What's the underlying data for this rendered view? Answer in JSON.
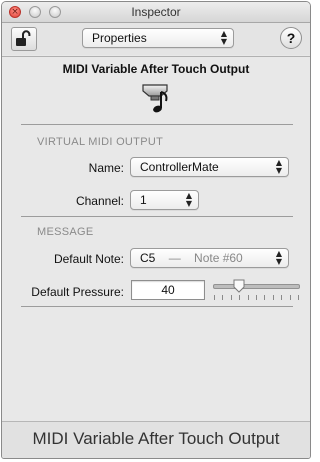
{
  "window": {
    "title": "Inspector"
  },
  "toolbar": {
    "view_popup": {
      "selected": "Properties"
    },
    "help_label": "?"
  },
  "object": {
    "heading": "MIDI Variable After Touch Output",
    "icon": "midi-note-output-icon"
  },
  "virtual_midi_output": {
    "section_label": "VIRTUAL MIDI OUTPUT",
    "name_label": "Name:",
    "name_value": "ControllerMate",
    "channel_label": "Channel:",
    "channel_value": "1"
  },
  "message": {
    "section_label": "MESSAGE",
    "default_note_label": "Default Note:",
    "default_note_value": "C5",
    "default_note_separator": "—",
    "default_note_detail": "Note #60",
    "default_pressure_label": "Default Pressure:",
    "default_pressure_value": "40",
    "pressure_slider_fraction": 0.3
  },
  "footer": {
    "title": "MIDI Variable After Touch Output"
  }
}
